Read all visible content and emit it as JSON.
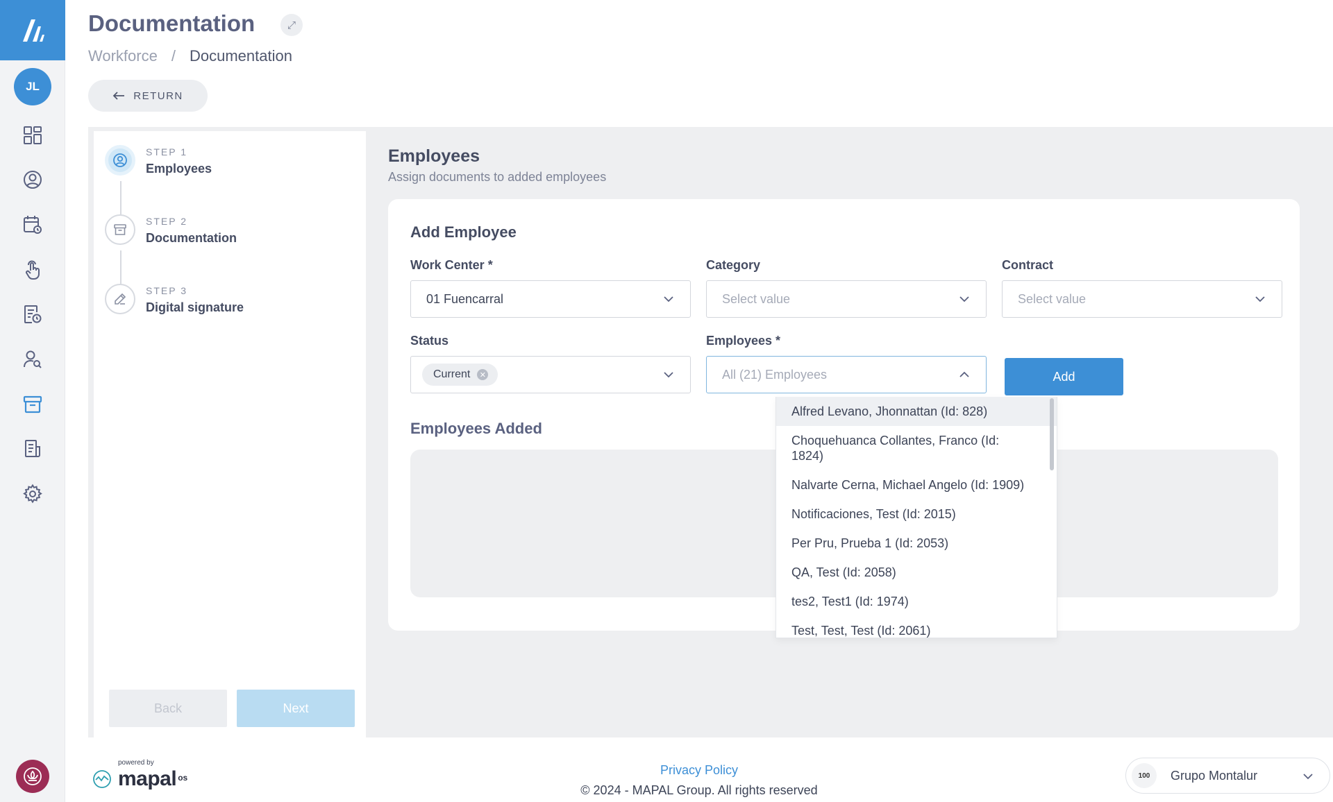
{
  "sidebar": {
    "avatar_initials": "JL",
    "nav_icons": [
      "dashboard-icon",
      "user-circle-icon",
      "calendar-clock-icon",
      "hand-touch-icon",
      "report-clock-icon",
      "user-search-icon",
      "archive-icon",
      "document-list-icon",
      "gear-icon"
    ]
  },
  "header": {
    "title": "Documentation",
    "breadcrumb": {
      "parent": "Workforce",
      "separator": "/",
      "current": "Documentation"
    },
    "return_label": "RETURN"
  },
  "steps": [
    {
      "label": "STEP 1",
      "name": "Employees",
      "active": true
    },
    {
      "label": "STEP 2",
      "name": "Documentation",
      "active": false
    },
    {
      "label": "STEP 3",
      "name": "Digital signature",
      "active": false
    }
  ],
  "nav_buttons": {
    "back": "Back",
    "next": "Next"
  },
  "content": {
    "title": "Employees",
    "subtitle": "Assign documents to added employees",
    "card_title": "Add Employee",
    "fields": {
      "work_center": {
        "label": "Work Center *",
        "value": "01 Fuencarral"
      },
      "category": {
        "label": "Category",
        "placeholder": "Select value"
      },
      "contract": {
        "label": "Contract",
        "placeholder": "Select value"
      },
      "status": {
        "label": "Status",
        "chip": "Current"
      },
      "employees": {
        "label": "Employees *",
        "placeholder": "All (21) Employees"
      }
    },
    "add_label": "Add",
    "employees_added_title": "Employees Added"
  },
  "dropdown_options": [
    "Alfred Levano, Jhonnattan (Id: 828)",
    "Choquehuanca Collantes, Franco (Id: 1824)",
    "Nalvarte Cerna, Michael Angelo (Id: 1909)",
    "Notificaciones, Test (Id: 2015)",
    "Per Pru, Prueba 1 (Id: 2053)",
    "QA, Test (Id: 2058)",
    "tes2, Test1 (Id: 1974)",
    "Test, Test, Test (Id: 2061)"
  ],
  "footer": {
    "powered_by": "powered by",
    "brand": "mapal",
    "brand_suffix": "os",
    "privacy": "Privacy Policy",
    "copyright": "© 2024 - MAPAL Group. All rights reserved",
    "company_logo": "100",
    "company": "Grupo Montalur"
  },
  "colors": {
    "primary": "#3d8fd6",
    "badge": "#9c2d55"
  }
}
